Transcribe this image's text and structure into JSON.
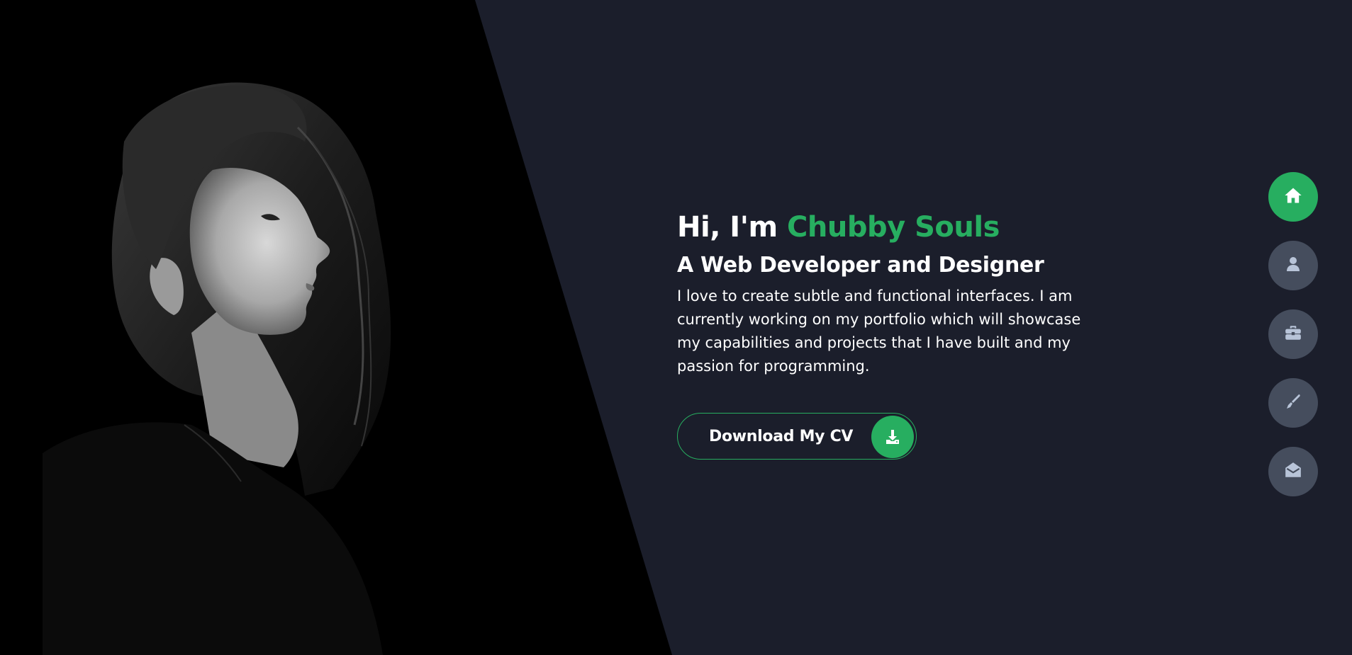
{
  "hero": {
    "greeting_prefix": "Hi, I'm ",
    "name": "Chubby Souls",
    "subtitle": "A Web Developer and Designer",
    "intro": "I love to create subtle and functional interfaces. I am currently working on my portfolio which will showcase my capabilities and projects that I have built and my passion for programming.",
    "cv_button_label": "Download My CV",
    "cv_button_icon": "download-icon"
  },
  "nav": {
    "items": [
      {
        "icon": "home-icon",
        "active": true
      },
      {
        "icon": "user-icon",
        "active": false
      },
      {
        "icon": "briefcase-icon",
        "active": false
      },
      {
        "icon": "pen-icon",
        "active": false
      },
      {
        "icon": "envelope-open-icon",
        "active": false
      }
    ]
  },
  "colors": {
    "background": "#1b1e2b",
    "accent": "#27ae60",
    "nav_inactive": "#454d5d",
    "icon_inactive": "#b8c4d8",
    "text": "#ffffff"
  }
}
